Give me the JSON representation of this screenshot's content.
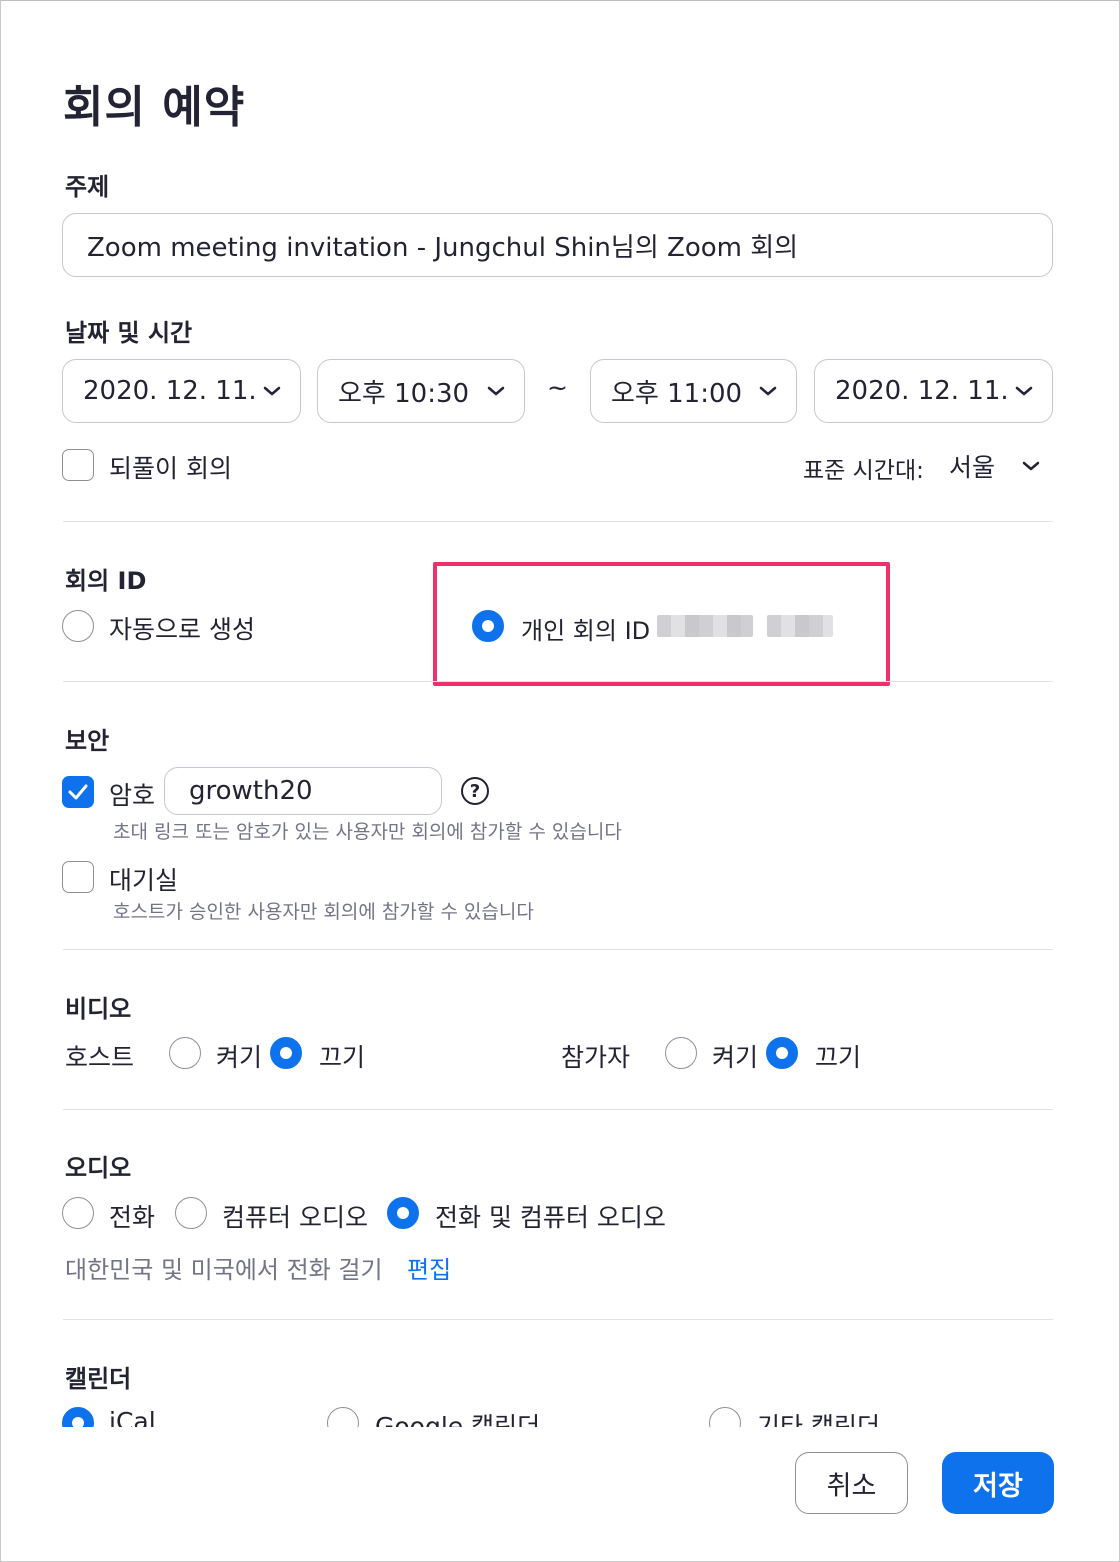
{
  "dialog": {
    "title": "회의 예약"
  },
  "topic": {
    "label": "주제",
    "value": "Zoom meeting invitation - Jungchul Shin님의 Zoom 회의"
  },
  "datetime": {
    "label": "날짜 및 시간",
    "start_date": "2020. 12.  11.",
    "start_time": "오후 10:30",
    "separator": "~",
    "end_time": "오후 11:00",
    "end_date": "2020. 12.  11.",
    "recurring_label": "되풀이 회의",
    "recurring_checked": false,
    "timezone_label": "표준 시간대:",
    "timezone_value": "서울"
  },
  "meeting_id": {
    "label": "회의 ID",
    "auto_label": "자동으로 생성",
    "personal_label": "개인 회의 ID",
    "selected": "personal",
    "highlight_color": "#f0306a"
  },
  "security": {
    "label": "보안",
    "passcode_label": "암호",
    "passcode_checked": true,
    "passcode_value": "growth20",
    "help_symbol": "?",
    "passcode_hint": "초대 링크 또는 암호가 있는 사용자만 회의에 참가할 수 있습니다",
    "waiting_room_label": "대기실",
    "waiting_room_checked": false,
    "waiting_room_hint": "호스트가 승인한 사용자만 회의에 참가할 수 있습니다"
  },
  "video": {
    "label": "비디오",
    "host_label": "호스트",
    "participant_label": "참가자",
    "on_label": "켜기",
    "off_label": "끄기",
    "host_selected": "off",
    "participant_selected": "off"
  },
  "audio": {
    "label": "오디오",
    "phone_label": "전화",
    "computer_label": "컴퓨터 오디오",
    "both_label": "전화 및 컴퓨터 오디오",
    "selected": "both",
    "dial_in_text": "대한민국 및 미국에서 전화 걸기",
    "edit_link": "편집"
  },
  "calendar": {
    "label": "캘린더",
    "options": [
      "iCal",
      "Google 캘린더",
      "기타 캘린더"
    ],
    "selected": "iCal"
  },
  "footer": {
    "cancel_label": "취소",
    "save_label": "저장"
  },
  "colors": {
    "accent": "#0e72ed",
    "text": "#232333",
    "muted": "#747487"
  }
}
